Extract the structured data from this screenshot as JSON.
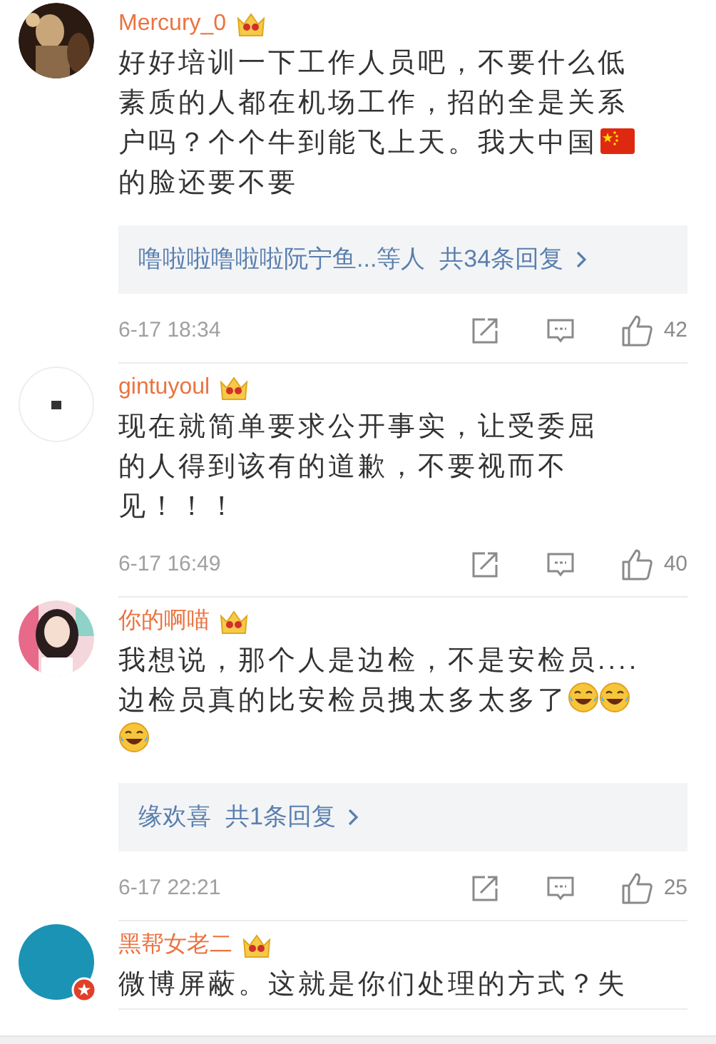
{
  "comments": [
    {
      "avatar": {
        "kind": "picture"
      },
      "name": "Mercury_0",
      "vip": true,
      "lines": [
        [
          {
            "kind": "text",
            "text": "好好培训一下工作人员吧，不要什么低"
          }
        ],
        [
          {
            "kind": "text",
            "text": "素质的人都在机场工作，招的全是关系"
          }
        ],
        [
          {
            "kind": "text",
            "text": "户吗？个个牛到能飞上天。我大中国"
          },
          {
            "kind": "flag"
          }
        ],
        [
          {
            "kind": "text",
            "text": "的脸还要不要"
          }
        ]
      ],
      "replies": {
        "users": "噜啦啦噜啦啦阮宁鱼...等人",
        "count": "共34条回复"
      },
      "time": "6-17 18:34",
      "likes": "42"
    },
    {
      "avatar": {
        "kind": "picture"
      },
      "name": "gintuyoul",
      "vip": true,
      "lines": [
        [
          {
            "kind": "text",
            "text": "现在就简单要求公开事实，让受委屈"
          }
        ],
        [
          {
            "kind": "text",
            "text": "的人得到该有的道歉，不要视而不"
          }
        ],
        [
          {
            "kind": "text",
            "text": "见！！！"
          }
        ]
      ],
      "time": "6-17 16:49",
      "likes": "40"
    },
    {
      "avatar": {
        "kind": "figure"
      },
      "name": "你的啊喵",
      "vip": true,
      "lines": [
        [
          {
            "kind": "text",
            "text": "我想说，那个人是边检，不是安检员...."
          }
        ],
        [
          {
            "kind": "text",
            "text": "边检员真的比安检员拽太多太多了"
          },
          {
            "kind": "laugh"
          },
          {
            "kind": "laugh"
          }
        ],
        [
          {
            "kind": "laugh"
          }
        ]
      ],
      "replies": {
        "users": "缘欢喜",
        "count": "共1条回复"
      },
      "time": "6-17 22:21",
      "likes": "25"
    },
    {
      "avatar": {
        "kind": "plain",
        "color": "#1a93b5",
        "badge": true
      },
      "name": "黑帮女老二",
      "vip": true,
      "lines": [
        [
          {
            "kind": "text",
            "text": "微博屏蔽。这就是你们处理的方式？失"
          }
        ]
      ]
    }
  ]
}
